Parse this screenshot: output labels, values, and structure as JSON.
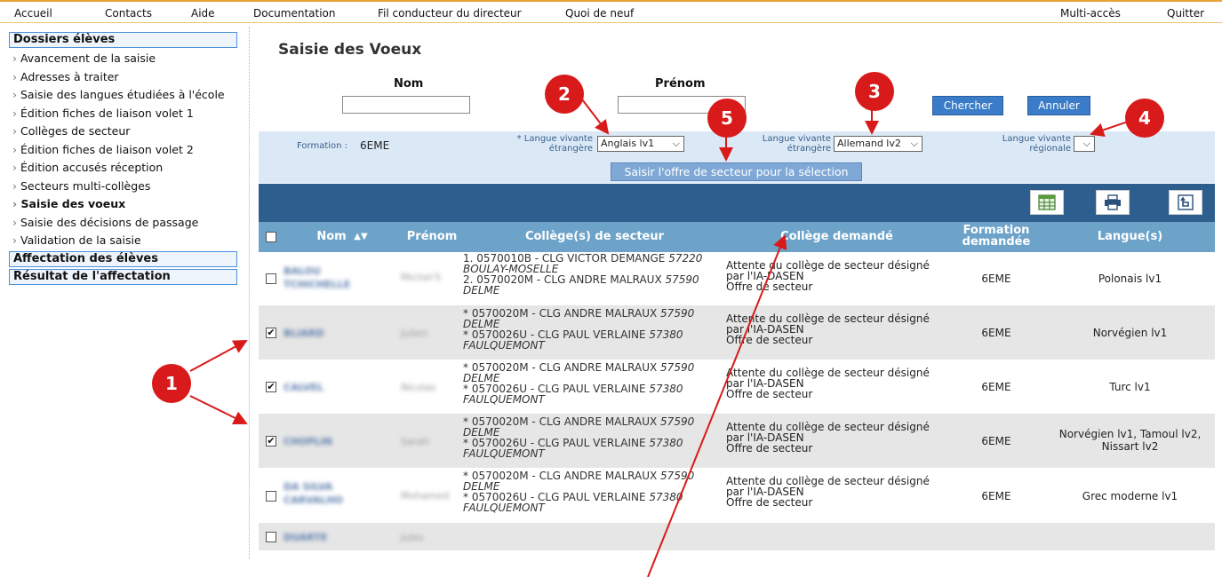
{
  "menu": {
    "accueil": "Accueil",
    "contacts": "Contacts",
    "aide": "Aide",
    "documentation": "Documentation",
    "fil": "Fil conducteur du directeur",
    "quoi": "Quoi de neuf",
    "multi": "Multi-accès",
    "quitter": "Quitter"
  },
  "sidebar": {
    "section1": "Dossiers élèves",
    "items": [
      "Avancement de la saisie",
      "Adresses à traiter",
      "Saisie des langues étudiées à l'école",
      "Édition fiches de liaison volet 1",
      "Collèges de secteur",
      "Édition fiches de liaison volet 2",
      "Édition accusés réception",
      "Secteurs multi-collèges",
      "Saisie des voeux",
      "Saisie des décisions de passage",
      "Validation de la saisie"
    ],
    "section2": "Affectation des élèves",
    "section3": "Résultat de l'affectation"
  },
  "page_title": "Saisie des Voeux",
  "search": {
    "nom_label": "Nom",
    "prenom_label": "Prénom",
    "nom_value": "",
    "prenom_value": "",
    "chercher": "Chercher",
    "annuler": "Annuler"
  },
  "filters": {
    "formation_label": "Formation :",
    "formation_value": "6EME",
    "lv_etrangere_label1": "* Langue vivante",
    "lv_etrangere_label2": "étrangère",
    "lv1_value": "Anglais lv1",
    "lv2_label1": "Langue vivante",
    "lv2_label2": "étrangère",
    "lv2_value": "Allemand lv2",
    "lvr_label1": "Langue vivante",
    "lvr_label2": "régionale",
    "lvr_value": "",
    "offre_button": "Saisir l'offre de secteur pour la sélection"
  },
  "table": {
    "headers": {
      "nom": "Nom",
      "prenom": "Prénom",
      "college_secteur": "Collège(s) de secteur",
      "college_demande": "Collège demandé",
      "formation1": "Formation",
      "formation2": "demandée",
      "langues": "Langue(s)"
    },
    "rows": [
      {
        "checked": false,
        "nom1": "BALOU",
        "nom2": "TCHICHELLE",
        "prenom": "Michel'S",
        "sect": [
          [
            "1. 0570010B - CLG VICTOR DEMANGE ",
            "57220"
          ],
          [
            "",
            "BOULAY-MOSELLE"
          ],
          [
            "2. 0570020M - CLG ANDRE MALRAUX ",
            "57590"
          ],
          [
            "",
            "DELME"
          ]
        ],
        "dem": [
          "Attente du collège de secteur désigné",
          "par l'IA-DASEN",
          "Offre de secteur"
        ],
        "formation": "6EME",
        "langues": [
          "Polonais lv1"
        ]
      },
      {
        "checked": true,
        "nom1": "BLIARD",
        "nom2": "",
        "prenom": "Julien",
        "sect": [
          [
            "* 0570020M - CLG ANDRE MALRAUX ",
            "57590"
          ],
          [
            "",
            "DELME"
          ],
          [
            "* 0570026U - CLG PAUL VERLAINE ",
            "57380"
          ],
          [
            "",
            "FAULQUEMONT"
          ]
        ],
        "dem": [
          "Attente du collège de secteur désigné",
          "par l'IA-DASEN",
          "Offre de secteur"
        ],
        "formation": "6EME",
        "langues": [
          "Norvégien lv1"
        ]
      },
      {
        "checked": true,
        "nom1": "CALVEL",
        "nom2": "",
        "prenom": "Nicolas",
        "sect": [
          [
            "* 0570020M - CLG ANDRE MALRAUX ",
            "57590"
          ],
          [
            "",
            "DELME"
          ],
          [
            "* 0570026U - CLG PAUL VERLAINE ",
            "57380"
          ],
          [
            "",
            "FAULQUEMONT"
          ]
        ],
        "dem": [
          "Attente du collège de secteur désigné",
          "par l'IA-DASEN",
          "Offre de secteur"
        ],
        "formation": "6EME",
        "langues": [
          "Turc lv1"
        ]
      },
      {
        "checked": true,
        "nom1": "CHOPLIN",
        "nom2": "",
        "prenom": "Sarah",
        "sect": [
          [
            "* 0570020M - CLG ANDRE MALRAUX ",
            "57590"
          ],
          [
            "",
            "DELME"
          ],
          [
            "* 0570026U - CLG PAUL VERLAINE ",
            "57380"
          ],
          [
            "",
            "FAULQUEMONT"
          ]
        ],
        "dem": [
          "Attente du collège de secteur désigné",
          "par l'IA-DASEN",
          "Offre de secteur"
        ],
        "formation": "6EME",
        "langues": [
          "Norvégien lv1, Tamoul lv2,",
          "Nissart lv2"
        ]
      },
      {
        "checked": false,
        "nom1": "DA SILVA",
        "nom2": "CARVALHO",
        "prenom": "Mohamed",
        "sect": [
          [
            "* 0570020M - CLG ANDRE MALRAUX ",
            "57590"
          ],
          [
            "",
            "DELME"
          ],
          [
            "* 0570026U - CLG PAUL VERLAINE ",
            "57380"
          ],
          [
            "",
            "FAULQUEMONT"
          ]
        ],
        "dem": [
          "Attente du collège de secteur désigné",
          "par l'IA-DASEN",
          "Offre de secteur"
        ],
        "formation": "6EME",
        "langues": [
          "Grec moderne lv1"
        ]
      },
      {
        "checked": false,
        "nom1": "DUARTE",
        "nom2": "",
        "prenom": "Jules",
        "sect": [],
        "dem": [],
        "formation": "",
        "langues": []
      }
    ]
  },
  "annotations": [
    "1",
    "2",
    "3",
    "4",
    "5"
  ],
  "colors": {
    "accent": "#d81a1a",
    "toolbar": "#2e5e8e",
    "header": "#6da3c9",
    "filter_bg": "#dbe9f7"
  }
}
